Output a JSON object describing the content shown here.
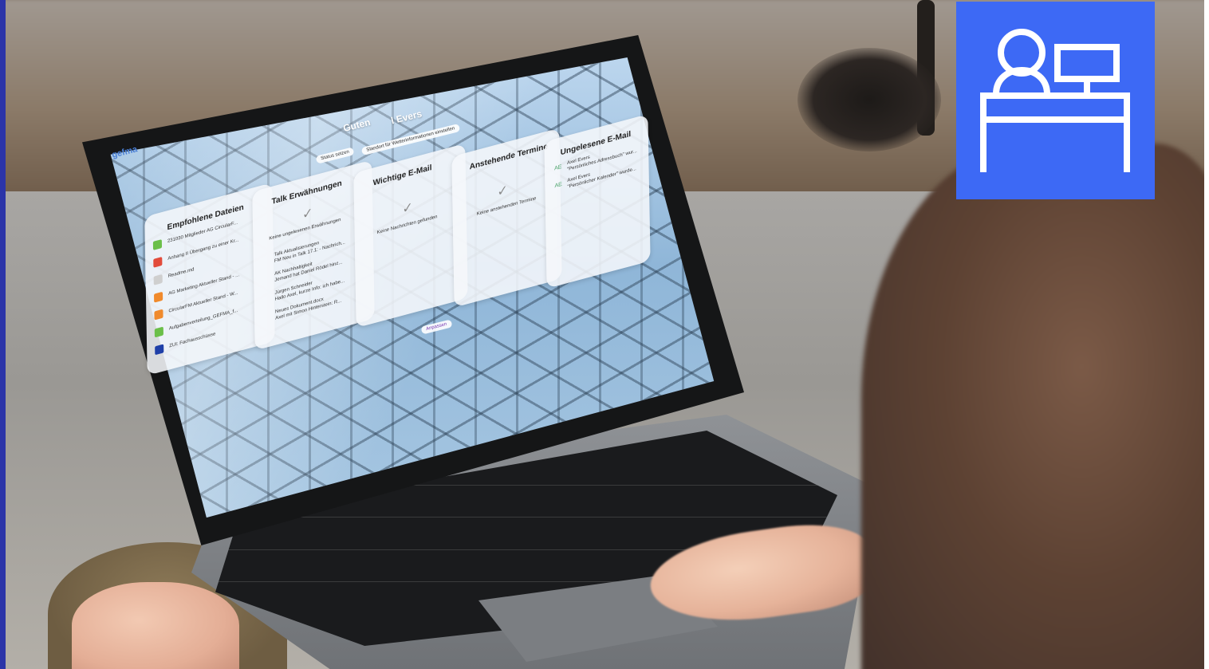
{
  "logo_badge": {
    "color": "#3d69f5",
    "icon": "person-at-desk-icon"
  },
  "screen": {
    "brand": "gefma",
    "greeting_visible": "Guten",
    "greeting_name": "l Evers",
    "status_button": "Status setzen",
    "location_button": "Standort für Wetterinformationen einstellen",
    "customize_button": "Anpassen",
    "cards": {
      "files": {
        "title": "Empfohlene Dateien",
        "items": [
          "231030 Mitglieder AG CircularF...",
          "Anhang II Übergang zu einer Kr...",
          "Readme.md",
          "AG Marketing Aktueller Stand - ...",
          "CircularFM Aktueller Stand - W...",
          "Aufgabenverteilung_GEFMA_f...",
          "ZUI: Fachausschüsse"
        ]
      },
      "talk": {
        "title": "Talk Erwähnungen",
        "empty": "Keine ungelesenen Erwähnungen",
        "items": [
          {
            "title": "Talk Aktualisierungen",
            "sub": "FM Neu in Talk 17.1: - Nachrich..."
          },
          {
            "title": "AK Nachhaltigkeit",
            "sub": "Jemand hat Daniel Rödel hinz..."
          },
          {
            "title": "Jürgen Schneider",
            "sub": "Hallo Axel, kurze Info: ich habe..."
          },
          {
            "title": "Neues Dokument.docx",
            "sub": "Axel mit Simon Hinterstein: R..."
          }
        ]
      },
      "mail": {
        "title": "Wichtige E-Mail",
        "empty": "Keine Nachrichten gefunden"
      },
      "events": {
        "title": "Anstehende Termine",
        "empty": "Keine anstehenden Termine"
      },
      "unread": {
        "title": "Ungelesene E-Mail",
        "items": [
          {
            "avatar": "AE",
            "title": "Axel Evers",
            "sub": "\"Persönliches Adressbuch\" wur..."
          },
          {
            "avatar": "AE",
            "title": "Axel Evers",
            "sub": "\"Persönlicher Kalender\" wurde..."
          }
        ]
      }
    }
  }
}
